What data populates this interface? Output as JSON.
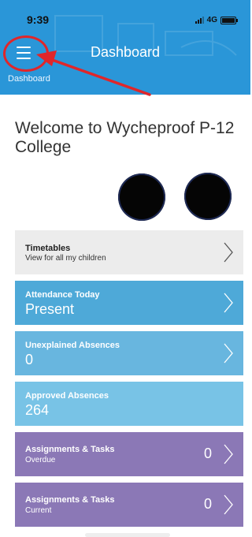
{
  "status": {
    "time": "9:39",
    "network": "4G"
  },
  "header": {
    "title": "Dashboard",
    "breadcrumb": "Dashboard"
  },
  "welcome": "Welcome to Wycheproof P-12 College",
  "icons": {
    "menu": "hamburger-menu-icon",
    "chevron": "chevron-right-icon"
  },
  "annotation_color": "#e0262a",
  "cards": [
    {
      "title": "Timetables",
      "subtitle": "View for all my children",
      "value": "",
      "color": "#ececec"
    },
    {
      "title": "Attendance Today",
      "subtitle": "",
      "value_main": "Present",
      "color": "#4ea9d8"
    },
    {
      "title": "Unexplained Absences",
      "subtitle": "",
      "value_main": "0",
      "color": "#68b6df"
    },
    {
      "title": "Approved Absences",
      "subtitle": "",
      "value_main": "264",
      "color": "#78c3e6"
    },
    {
      "title": "Assignments & Tasks",
      "subtitle": "Overdue",
      "count": "0",
      "color": "#8b78b6"
    },
    {
      "title": "Assignments & Tasks",
      "subtitle": "Current",
      "count": "0",
      "color": "#8b78b6"
    }
  ]
}
